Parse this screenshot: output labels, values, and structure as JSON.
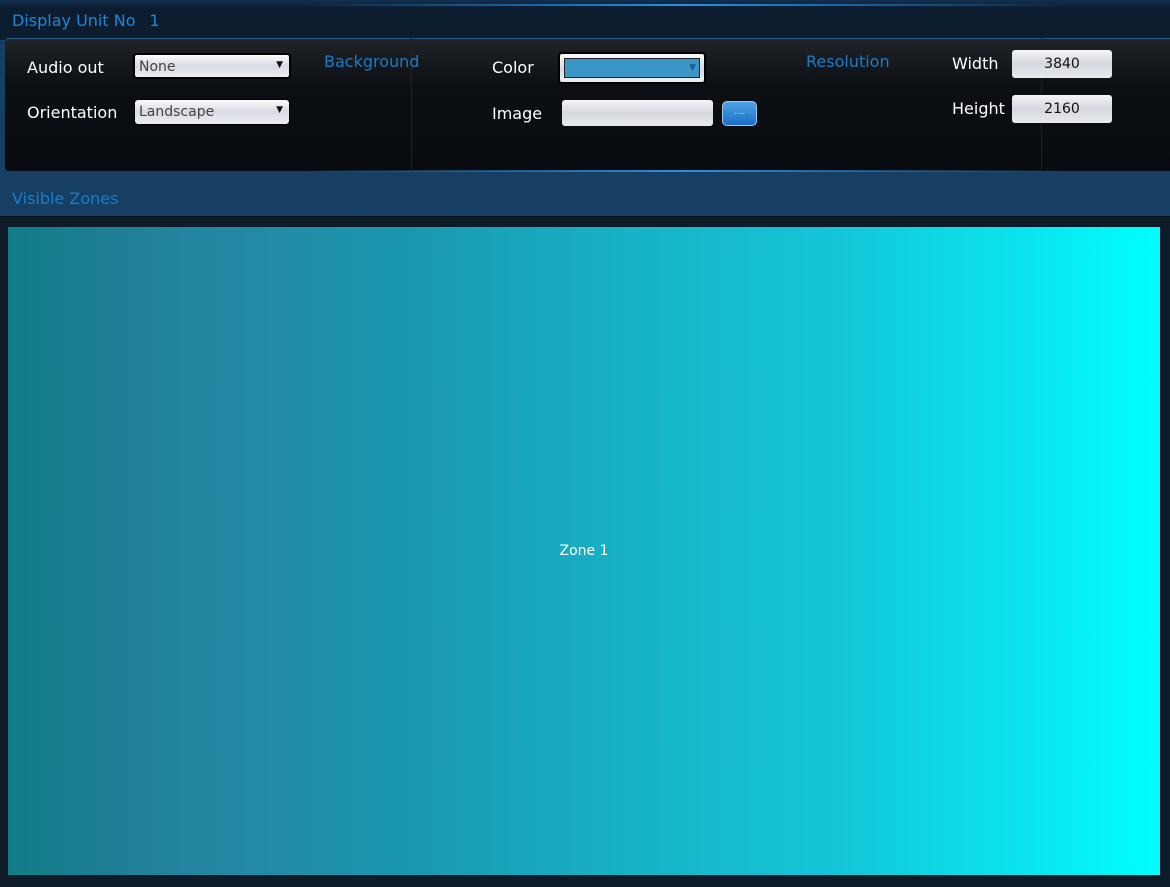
{
  "header": {
    "title": "Display Unit No",
    "unit_number": "1"
  },
  "settings": {
    "audio_out": {
      "label": "Audio out",
      "value": "None"
    },
    "orientation": {
      "label": "Orientation",
      "value": "Landscape"
    },
    "background": {
      "section_label": "Background",
      "color_label": "Color",
      "color_value": "#3a97c8",
      "image_label": "Image",
      "image_value": "",
      "browse_label": "...."
    },
    "resolution": {
      "section_label": "Resolution",
      "width_label": "Width",
      "width_value": "3840",
      "height_label": "Height",
      "height_value": "2160"
    }
  },
  "zones": {
    "section_label": "Visible Zones",
    "items": [
      {
        "name": "Zone 1"
      }
    ]
  }
}
